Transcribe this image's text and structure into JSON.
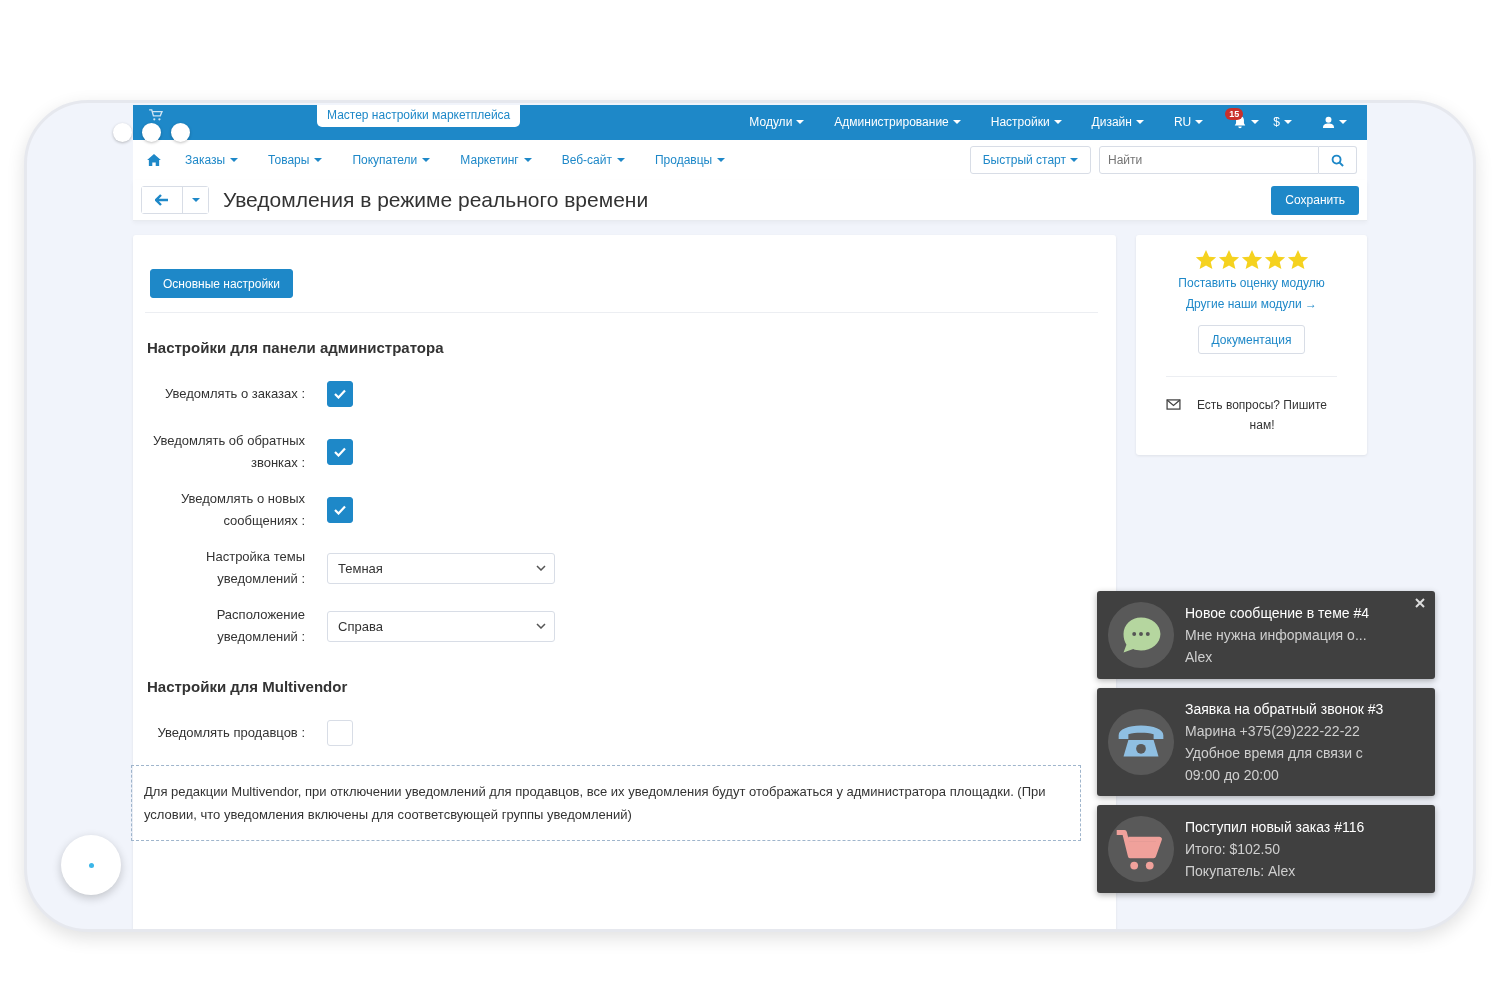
{
  "wizard_tab": {
    "label": "Мастер настройки маркетплейса"
  },
  "top_menu": [
    {
      "label": "Модули"
    },
    {
      "label": "Администрирование"
    },
    {
      "label": "Настройки"
    },
    {
      "label": "Дизайн"
    },
    {
      "label": "RU"
    }
  ],
  "notifications": {
    "count": "15"
  },
  "currency": {
    "label": "$"
  },
  "nav": [
    {
      "label": "Заказы"
    },
    {
      "label": "Товары"
    },
    {
      "label": "Покупатели"
    },
    {
      "label": "Маркетинг"
    },
    {
      "label": "Веб-сайт"
    },
    {
      "label": "Продавцы"
    }
  ],
  "quick_start": {
    "label": "Быстрый старт"
  },
  "search": {
    "placeholder": "Найти"
  },
  "page_title": "Уведомления в режиме реального времени",
  "save_button": "Сохранить",
  "tabs": [
    {
      "label": "Основные настройки",
      "selected": true
    }
  ],
  "sections": [
    {
      "title": "Настройки для панели администратора",
      "fields": [
        {
          "kind": "checkbox",
          "label": "Уведомлять о заказах :",
          "checked": true
        },
        {
          "kind": "checkbox",
          "label": "Уведомлять об обратных звонках :",
          "checked": true
        },
        {
          "kind": "checkbox",
          "label": "Уведомлять о новых сообщениях :",
          "checked": true
        },
        {
          "kind": "select",
          "label": "Настройка темы уведомлений :",
          "value": "Темная"
        },
        {
          "kind": "select",
          "label": "Расположение уведомлений :",
          "value": "Справа"
        }
      ]
    },
    {
      "title": "Настройки для Multivendor",
      "fields": [
        {
          "kind": "checkbox",
          "label": "Уведомлять продавцов :",
          "checked": false
        }
      ],
      "note": "Для редакции Multivendor, при отключении уведомлений для продавцов, все их уведомления будут отображаться у администратора площадки. (При условии, что уведомления включены для соответсвующей группы уведомлений)"
    }
  ],
  "sidebar": {
    "stars": 5,
    "rate_link": "Поставить оценку модулю",
    "modules_link": "Другие наши модули →",
    "docs_button": "Документация",
    "contact": "Есть вопросы? Пишите нам!"
  },
  "toasts": [
    {
      "kind": "message",
      "title": "Новое сообщение в теме #4",
      "lines": [
        "Мне нужна информация о...",
        "Alex"
      ],
      "closable": true
    },
    {
      "kind": "call",
      "title": "Заявка на обратный звонок #3",
      "lines": [
        "Марина +375(29)222-22-22",
        "Удобное время для связи с 09:00 до 20:00"
      ],
      "closable": false
    },
    {
      "kind": "order",
      "title": "Поступил новый заказ #116",
      "lines": [
        "Итого: $102.50",
        "Покупатель: Alex"
      ],
      "closable": false
    }
  ]
}
